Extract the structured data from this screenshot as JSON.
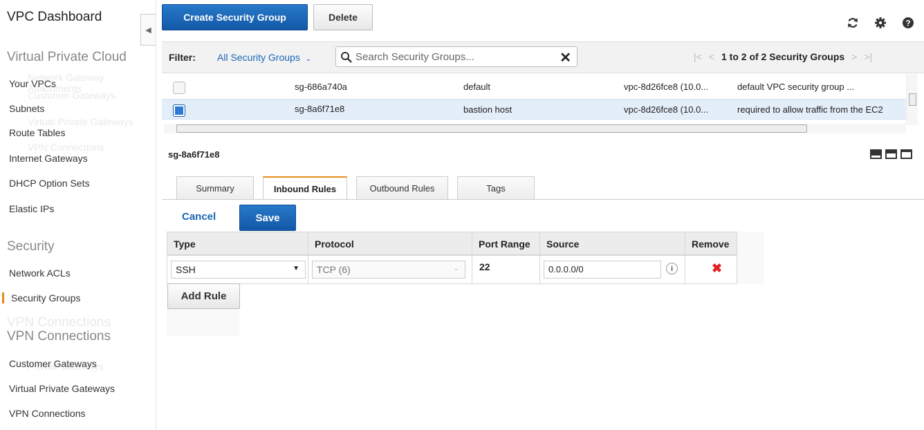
{
  "sidebar": {
    "title": "VPC Dashboard",
    "collapse_icon": "chevron-left-icon",
    "sections": [
      {
        "heading": "Virtual Private Cloud",
        "items": [
          "Your VPCs",
          "Subnets",
          "Route Tables",
          "Internet Gateways",
          "DHCP Option Sets",
          "Elastic IPs"
        ]
      },
      {
        "heading": "Security",
        "items": [
          "Network ACLs",
          "Security Groups"
        ]
      },
      {
        "heading": "VPN Connections",
        "items": [
          "Customer Gateways",
          "Virtual Private Gateways",
          "VPN Connections"
        ]
      }
    ],
    "active_item": "Security Groups"
  },
  "toolbar": {
    "create_label": "Create Security Group",
    "delete_label": "Delete",
    "icons": [
      "refresh-icon",
      "gear-icon",
      "help-icon"
    ]
  },
  "filter": {
    "label": "Filter:",
    "dropdown_value": "All Security Groups",
    "search_placeholder": "Search Security Groups...",
    "pager_text": "1 to 2 of 2 Security Groups"
  },
  "groups": [
    {
      "id": "sg-686a740a",
      "name": "default",
      "vpc": "vpc-8d26fce8 (10.0...",
      "description": "default VPC security group ...",
      "selected": false
    },
    {
      "id": "sg-8a6f71e8",
      "name": "bastion host",
      "vpc": "vpc-8d26fce8 (10.0...",
      "description": "required to allow traffic from the EC2",
      "selected": true
    }
  ],
  "detail": {
    "group_id": "sg-8a6f71e8",
    "tabs": [
      "Summary",
      "Inbound Rules",
      "Outbound Rules",
      "Tags"
    ],
    "active_tab": "Inbound Rules",
    "cancel_label": "Cancel",
    "save_label": "Save",
    "rules_headers": [
      "Type",
      "Protocol",
      "Port Range",
      "Source",
      "Remove"
    ],
    "rule": {
      "type": "SSH",
      "protocol": "TCP (6)",
      "port_range": "22",
      "source": "0.0.0.0/0"
    },
    "add_rule_label": "Add Rule"
  },
  "colors": {
    "primary_button": "#1a62b3",
    "accent": "#e88b1a",
    "link": "#1a66b7",
    "selected_row": "#e4eef9",
    "remove": "#dd2222"
  }
}
